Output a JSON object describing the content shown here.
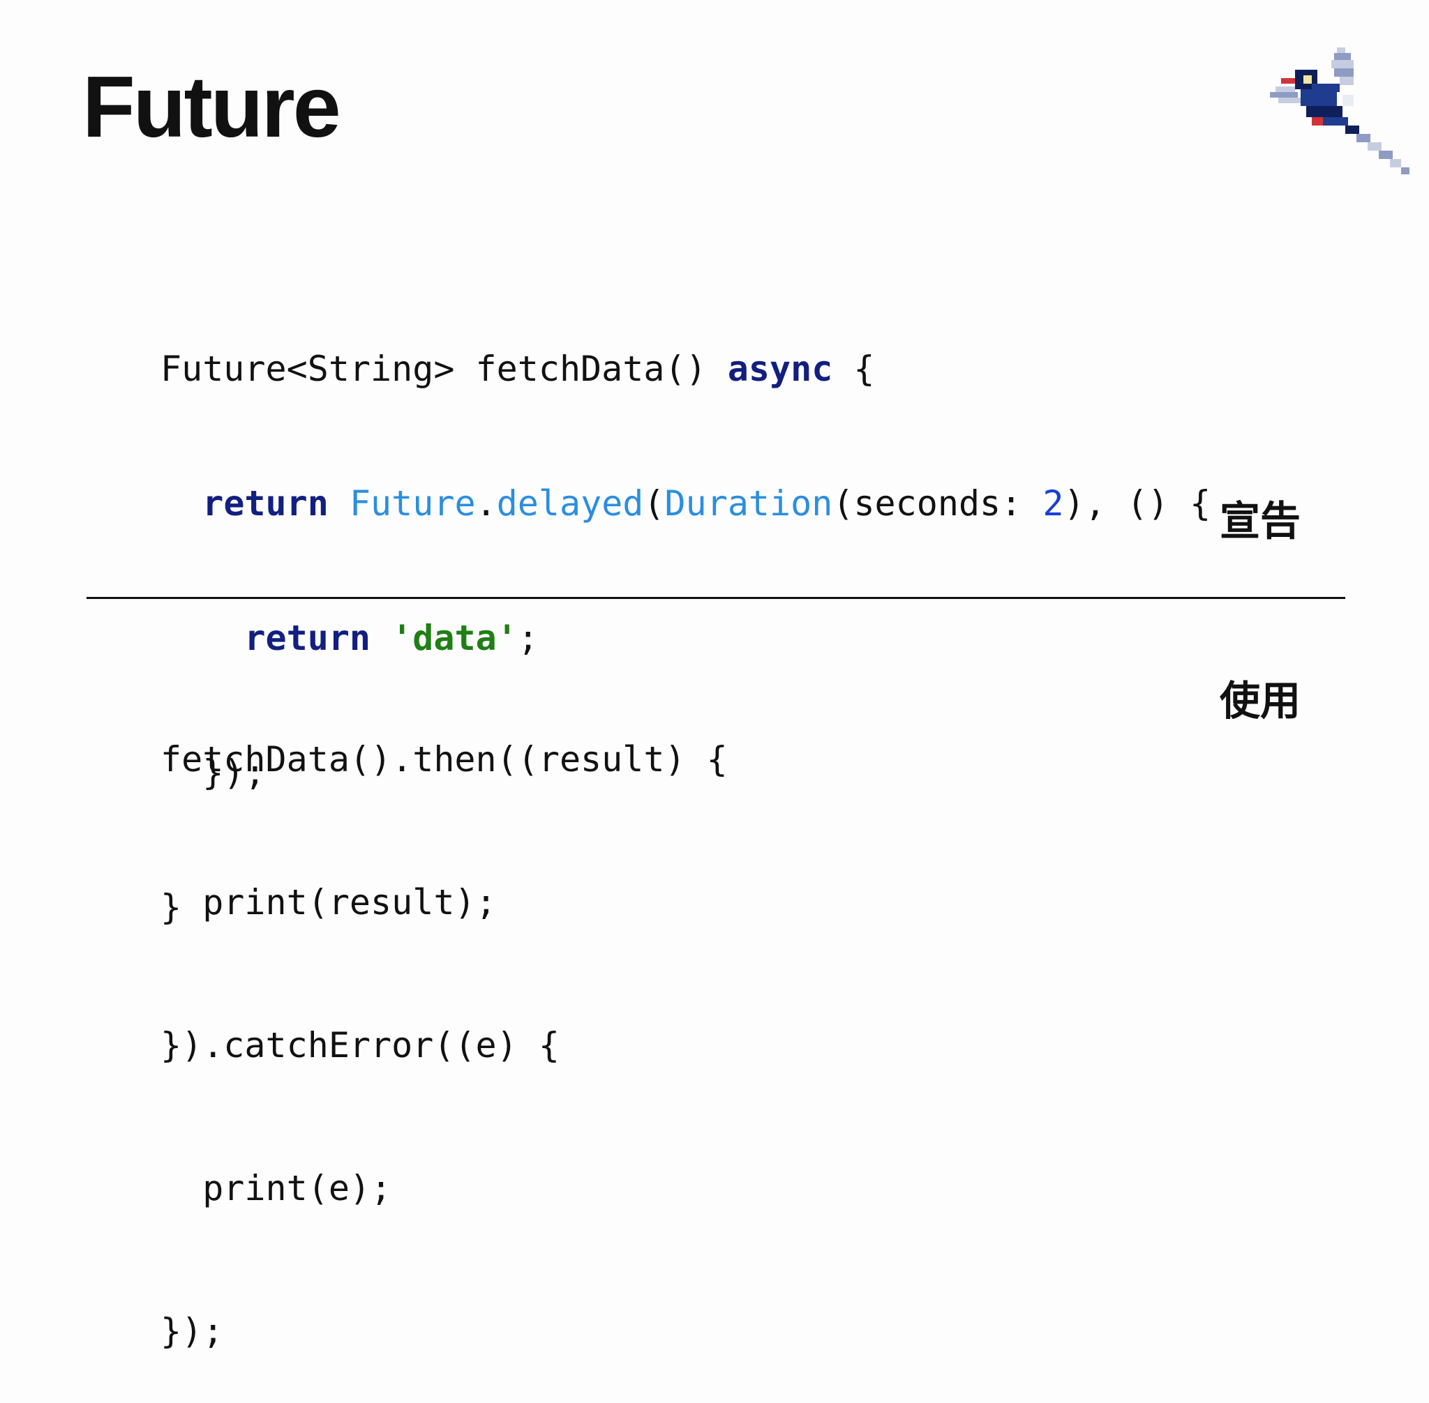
{
  "slide": {
    "title": "Future",
    "declaration_label": "宣告",
    "usage_label": "使用"
  },
  "declaration_code": {
    "l1_type": "Future<String>",
    "l1_name": " fetchData() ",
    "l1_kw": "async",
    "l1_end": " {",
    "l2_indent": "  ",
    "l2_kw": "return",
    "l2_sp": " ",
    "l2_cls1": "Future",
    "l2_dot": ".",
    "l2_method": "delayed",
    "l2_paren": "(",
    "l2_cls2": "Duration",
    "l2_args": "(seconds: ",
    "l2_num": "2",
    "l2_end": "), () {",
    "l3_indent": "    ",
    "l3_kw": "return",
    "l3_sp": " ",
    "l3_str": "'data'",
    "l3_end": ";",
    "l4": "  });",
    "l5": "}"
  },
  "usage_code": {
    "l1": "fetchData().then((result) {",
    "l2": "  print(result);",
    "l3": "}).catchError((e) {",
    "l4": "  print(e);",
    "l5": "});"
  },
  "logo": {
    "icon": "pixel-bird-icon",
    "colors": {
      "body": "#1f3c8f",
      "body_dark": "#0f1f5a",
      "wing": "#8e9cc4",
      "wing_light": "#c7cde0",
      "beak": "#d0343a",
      "eye": "#f2e6a0"
    }
  }
}
